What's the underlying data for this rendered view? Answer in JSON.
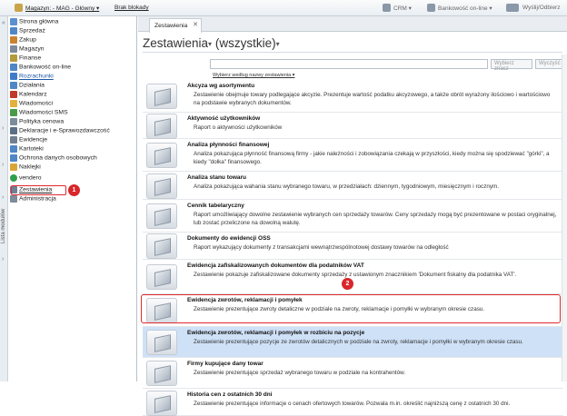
{
  "topbar": {
    "warehouse": "Magazyn: - MAG - Główny ▾",
    "locks": "Brak blokady",
    "crm": "CRM ▾",
    "bank": "Bankowość on-line ▾",
    "send": "Wyślij/Odbierz"
  },
  "leftstrip": {
    "label": "Lista modułów"
  },
  "sidebar": {
    "items": [
      {
        "label": "Strona główna",
        "color": "#5a8fd0"
      },
      {
        "label": "Sprzedaż",
        "color": "#4f86c6"
      },
      {
        "label": "Zakup",
        "color": "#c9822f"
      },
      {
        "label": "Magazyn",
        "color": "#7d8b9a"
      },
      {
        "label": "Finanse",
        "color": "#b59a3a"
      },
      {
        "label": "Bankowość on-line",
        "color": "#4f86c6"
      },
      {
        "label": "Rozrachunki",
        "color": "#3d7cc9"
      },
      {
        "label": "Działania",
        "color": "#4f86c6"
      },
      {
        "label": "Kalendarz",
        "color": "#c0392b"
      },
      {
        "label": "Wiadomości",
        "color": "#e3b23c"
      },
      {
        "label": "Wiadomości SMS",
        "color": "#4a9a4a"
      },
      {
        "label": "Polityka cenowa",
        "color": "#7b8c9c"
      },
      {
        "label": "Deklaracje i e-Sprawozdawczość",
        "color": "#5b6f85"
      },
      {
        "label": "Ewidencje",
        "color": "#6f7f8f"
      },
      {
        "label": "Kartoteki",
        "color": "#4f86c6"
      },
      {
        "label": "Ochrona danych osobowych",
        "color": "#4f86c6"
      },
      {
        "label": "Naklejki",
        "color": "#d9a536"
      },
      {
        "label": "vendero",
        "color": "#2f9f4a"
      },
      {
        "label": "Zestawienia",
        "color": "#6e8193"
      },
      {
        "label": "Administracja",
        "color": "#7d8b9a"
      }
    ]
  },
  "badges": {
    "one": "1",
    "two": "2"
  },
  "tab": {
    "label": "Zestawienia",
    "close": "✕"
  },
  "header": {
    "title": "Zestawienia",
    "filter": "(wszystkie)"
  },
  "search": {
    "button_search": "Wybierz znacz",
    "button_clear": "Wyczyść"
  },
  "sort": {
    "label": "Wybierz według nazwy zestawienia ▾"
  },
  "reports": [
    {
      "title": "Akcyza wg asortymentu",
      "desc": "Zestawienie obejmuje towary podlegające akcyzie. Prezentuje wartość podatku akcyzowego, a także obrót wyrażony ilościowo i wartościowo na podstawie wybranych dokumentów."
    },
    {
      "title": "Aktywność użytkowników",
      "desc": "Raport o aktywności użytkowników"
    },
    {
      "title": "Analiza płynności finansowej",
      "desc": "Analiza pokazująca płynność finansową firmy - jakie należności i zobowiązania czekają w przyszłości, kiedy można się spodziewać \"górki\", a kiedy \"dołka\" finansowego."
    },
    {
      "title": "Analiza stanu towaru",
      "desc": "Analiza pokazująca wahania stanu wybranego towaru, w przedziałach: dziennym, tygodniowym, miesięcznym i rocznym."
    },
    {
      "title": "Cennik tabelaryczny",
      "desc": "Raport umożliwiający dowolne zestawienie wybranych cen sprzedaży towarów. Ceny sprzedaży mogą być prezentowane w postaci oryginalnej, lub zostać przeliczone na dowolną walutę."
    },
    {
      "title": "Dokumenty do ewidencji OSS",
      "desc": "Raport wykazujący dokumenty z transakcjami wewnątrzwspólnotowej dostawy towarów na odległość"
    },
    {
      "title": "Ewidencja zafiskalizowanych dokumentów dla podatników VAT",
      "desc": "Zestawienie pokazuje zafiskalizowane dokumenty sprzedaży z ustawionym znacznikiem 'Dokument fiskalny dla podatnika VAT'."
    },
    {
      "title": "Ewidencja zwrotów, reklamacji i pomyłek",
      "desc": "Zestawienie prezentujące zwroty detaliczne w podziale na zwroty, reklamacje i pomyłki w wybranym okresie czasu."
    },
    {
      "title": "Ewidencja zwrotów, reklamacji i pomyłek w rozbiciu na pozycje",
      "desc": "Zestawienie prezentujące pozycje ze zwrotów detalicznych w podziale na zwroty, reklamacje i pomyłki w wybranym okresie czasu."
    },
    {
      "title": "Firmy kupujące dany towar",
      "desc": "Zestawienie prezentujące sprzedaż wybranego towaru w podziale na kontrahentów."
    },
    {
      "title": "Historia cen z ostatnich 30 dni",
      "desc": "Zestawienie prezentujące informacje o cenach ofertowych towarów. Pozwala m.in. określić najniższą cenę z ostatnich 30 dni."
    }
  ]
}
